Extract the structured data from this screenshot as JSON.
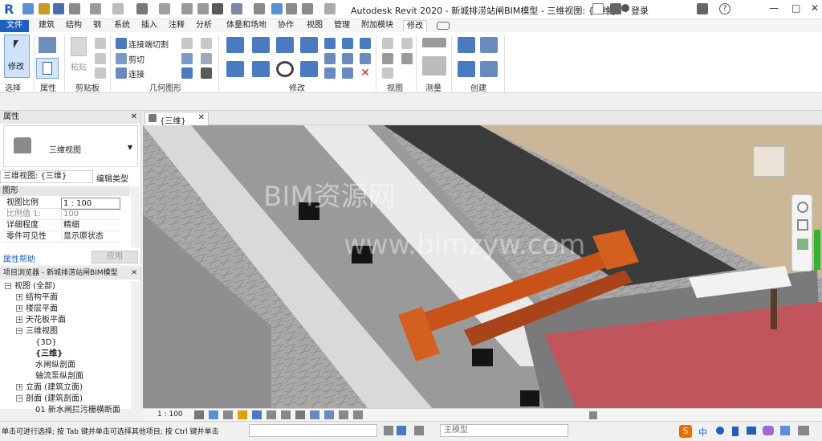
{
  "title_bar": {
    "app_title": "Autodesk Revit 2020 - 新城排涝站闸BIM模型 - 三维视图: {三维}",
    "login_label": "登录",
    "help_label": "?"
  },
  "menu": {
    "file": "文件",
    "tabs": [
      "建筑",
      "结构",
      "钢",
      "系统",
      "插入",
      "注释",
      "分析",
      "体量和场地",
      "协作",
      "视图",
      "管理",
      "附加模块",
      "修改"
    ]
  },
  "ribbon": {
    "select_label": "选择",
    "properties_label": "属性",
    "clipboard_label": "剪贴板",
    "geometry_label": "几何图形",
    "modify_panel_label": "修改",
    "view_label": "视图",
    "measure_label": "测量",
    "create_label": "创建",
    "modify_button": "修改",
    "paste_button": "粘贴",
    "join_cut": "连接端切割",
    "cut": "剪切",
    "join": "连接"
  },
  "properties": {
    "header": "属性",
    "type_name": "三维视图",
    "instance_selector": "三维视图: {三维}",
    "edit_type": "编辑类型",
    "section": "图形",
    "rows": [
      {
        "key": "视图比例",
        "value": "1 : 100"
      },
      {
        "key": "比例值 1:",
        "value": "100"
      },
      {
        "key": "详细程度",
        "value": "精细"
      },
      {
        "key": "零件可见性",
        "value": "显示原状态"
      }
    ],
    "help_link": "属性帮助",
    "apply_button": "应用"
  },
  "browser": {
    "header": "项目浏览器 - 新城排涝站闸BIM模型",
    "items": [
      {
        "label": "视图 (全部)",
        "level": 0
      },
      {
        "label": "结构平面",
        "level": 1
      },
      {
        "label": "楼层平面",
        "level": 1
      },
      {
        "label": "天花板平面",
        "level": 1
      },
      {
        "label": "三维视图",
        "level": 1
      },
      {
        "label": "{3D}",
        "level": 2
      },
      {
        "label": "{三维}",
        "level": 2
      },
      {
        "label": "水闸纵剖面",
        "level": 2
      },
      {
        "label": "轴流泵纵剖面",
        "level": 2
      },
      {
        "label": "立面 (建筑立面)",
        "level": 1
      },
      {
        "label": "剖面 (建筑剖面)",
        "level": 1
      },
      {
        "label": "01 新水闸拦污栅横断面",
        "level": 2
      }
    ]
  },
  "view_tab": {
    "label": "{三维}"
  },
  "view_control": {
    "scale": "1 : 100"
  },
  "watermark": {
    "line1": "BIM资源网",
    "line2": "www.bimzyw.com"
  },
  "status": {
    "message": "单击可进行选择; 按 Tab 键并单击可选择其他项目; 按 Ctrl 键并单击",
    "workset": "主模型",
    "ime_label": "中"
  },
  "colors": {
    "accent": "#1f5fbf",
    "crane": "#c9521b",
    "wall_red": "#c0555e",
    "ground": "#c8b899"
  }
}
